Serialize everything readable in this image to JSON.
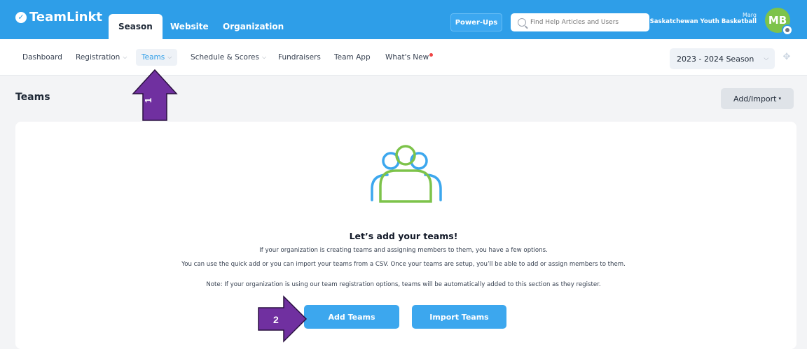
{
  "header": {
    "logo": "TeamLinkt",
    "tabs": [
      {
        "label": "Season"
      },
      {
        "label": "Website"
      },
      {
        "label": "Organization"
      }
    ],
    "powerups_label": "Power-Ups",
    "search_placeholder": "Find Help Articles and Users",
    "user_name": "Marg",
    "user_org": "Saskatchewan Youth Basketball",
    "avatar_initials": "MB"
  },
  "subnav": {
    "items": [
      {
        "label": "Dashboard"
      },
      {
        "label": "Registration"
      },
      {
        "label": "Teams"
      },
      {
        "label": "Schedule & Scores"
      },
      {
        "label": "Fundraisers"
      },
      {
        "label": "Team App"
      },
      {
        "label": "What's New"
      }
    ],
    "season": "2023 - 2024 Season"
  },
  "page": {
    "title": "Teams",
    "add_import": "Add/Import"
  },
  "empty_state": {
    "title": "Let’s add your teams!",
    "line1": "If your organization is creating teams and assigning members to them, you have a few options.",
    "line2": "You can use the quick add or you can import your teams from a CSV. Once your teams are setup, you’ll be able to add or assign members to them.",
    "note": "Note: If your organization is using our team registration options, teams will be automatically added to this section as they register.",
    "add_button": "Add Teams",
    "import_button": "Import Teams"
  },
  "annotations": {
    "step1": "1",
    "step2": "2",
    "color": "#7030a0"
  },
  "colors": {
    "brand": "#2e9ee8",
    "button": "#3ca7ee",
    "icon_blue": "#3ca7ee",
    "icon_green": "#7dc34a"
  }
}
